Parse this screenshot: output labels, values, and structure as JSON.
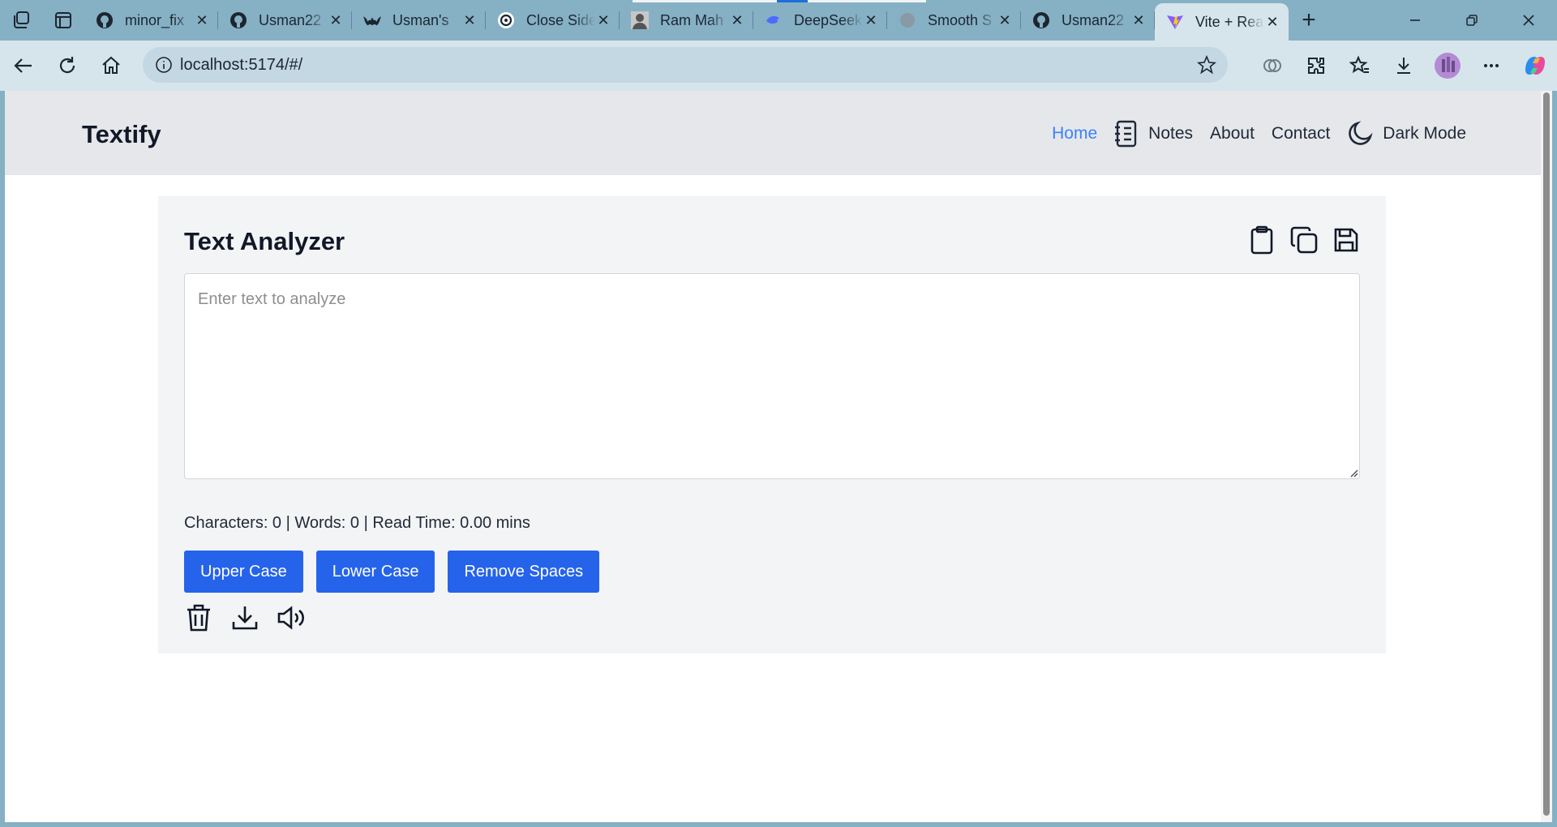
{
  "browser": {
    "tabs": [
      {
        "title": "minor_fix",
        "favicon": "github-icon"
      },
      {
        "title": "Usman22",
        "favicon": "github-icon"
      },
      {
        "title": "Usman's",
        "favicon": "bat-icon"
      },
      {
        "title": "Close Side",
        "favicon": "openai-icon"
      },
      {
        "title": "Ram Mah",
        "favicon": "avatar-icon"
      },
      {
        "title": "DeepSeek",
        "favicon": "deepseek-icon"
      },
      {
        "title": "Smooth S",
        "favicon": "globe-icon"
      },
      {
        "title": "Usman22",
        "favicon": "github-icon"
      },
      {
        "title": "Vite + React",
        "favicon": "vite-icon"
      }
    ],
    "active_tab_index": 8,
    "address": "localhost:5174/#/"
  },
  "app": {
    "brand": "Textify",
    "nav": {
      "home": "Home",
      "notes": "Notes",
      "about": "About",
      "contact": "Contact",
      "dark_mode": "Dark Mode"
    },
    "analyzer": {
      "title": "Text Analyzer",
      "placeholder": "Enter text to analyze",
      "stats": "Characters: 0 | Words: 0 | Read Time: 0.00 mins",
      "buttons": {
        "upper": "Upper Case",
        "lower": "Lower Case",
        "remove_spaces": "Remove Spaces"
      }
    }
  },
  "colors": {
    "accent": "#2563eb",
    "nav_active": "#3b82f6",
    "navbar_bg": "#e5e7eb",
    "card_bg": "#f3f4f6",
    "browser_frame": "#86b0c4"
  }
}
